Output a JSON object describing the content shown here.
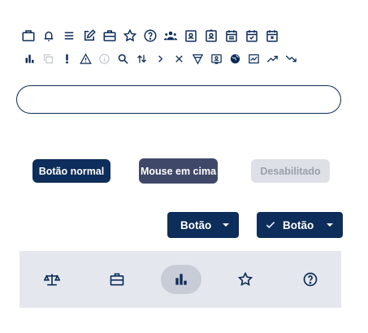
{
  "icon_row_1": [
    "briefcase-icon",
    "bell-icon",
    "menu-icon",
    "edit-icon",
    "toolbox-icon",
    "star-icon",
    "help-icon",
    "group-icon",
    "contact-card-icon",
    "id-badge-icon",
    "calendar-list-icon",
    "calendar-check-icon",
    "calendar-x-icon"
  ],
  "icon_row_2": [
    "bar-chart-icon",
    "copy-disabled-icon",
    "exclamation-icon",
    "warning-icon",
    "info-disabled-icon",
    "search-icon",
    "sort-icon",
    "chevron-right-icon",
    "close-icon",
    "filter-icon",
    "profile-card-icon",
    "globe-icon",
    "line-chart-icon",
    "trending-up-icon",
    "trending-down-icon"
  ],
  "search": {
    "placeholder": "",
    "value": ""
  },
  "buttons": {
    "normal": "Botão normal",
    "hover": "Mouse em cima",
    "disabled": "Desabilitado"
  },
  "dropdowns": {
    "plain_label": "Botão",
    "checked_label": "Botão"
  },
  "tabbar": {
    "items": [
      "scale-icon",
      "toolbox-icon",
      "bar-chart-icon",
      "star-icon",
      "help-icon"
    ],
    "active_index": 2
  },
  "colors": {
    "primary": "#0d2d5a",
    "hover": "#3f4868",
    "disabled_bg": "#dde1e7",
    "disabled_text": "#9aa0a8",
    "tabbar_bg": "#e4e8ee",
    "tab_active_bg": "#c7ccd6"
  }
}
